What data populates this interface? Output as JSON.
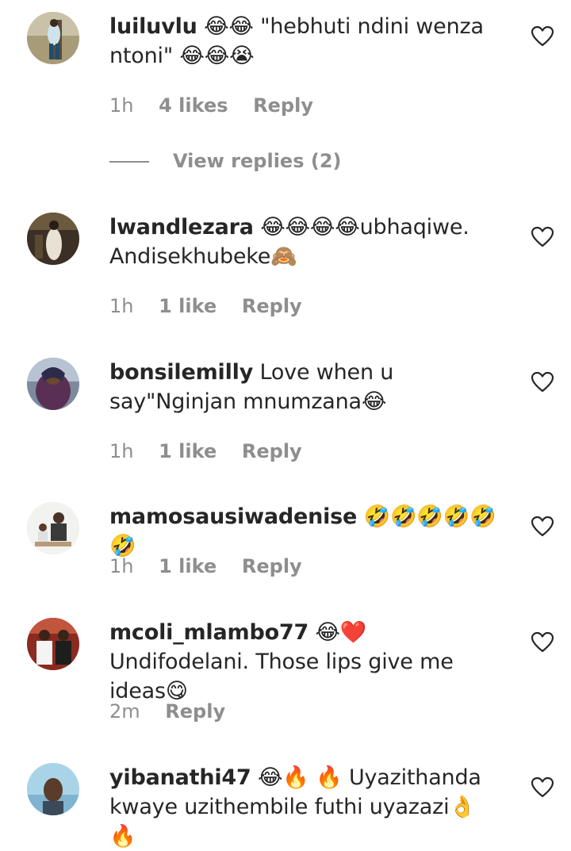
{
  "comments": [
    {
      "username": "luiluvlu",
      "text": "😂😂 \"hebhuti ndini wenza ntoni\" 😂😂😭",
      "time": "1h",
      "likes": "4 likes",
      "reply": "Reply",
      "view_replies": "View replies (2)"
    },
    {
      "username": "lwandlezara",
      "text": "😂😂😂😂ubhaqiwe. Andisekhubeke🙈",
      "time": "1h",
      "likes": "1 like",
      "reply": "Reply"
    },
    {
      "username": "bonsilemilly",
      "text": "Love when u say\"Nginjan mnumzana😂",
      "time": "1h",
      "likes": "1 like",
      "reply": "Reply"
    },
    {
      "username": "mamosausiwadenise",
      "text": "🤣🤣🤣🤣🤣🤣",
      "time": "1h",
      "likes": "1 like",
      "reply": "Reply"
    },
    {
      "username": "mcoli_mlambo77",
      "text": "😂❤️ Undifodelani. Those lips give me ideas😋",
      "time": "2m",
      "reply": "Reply"
    },
    {
      "username": "yibanathi47",
      "text": "😂🔥 🔥 Uyazithanda kwaye uzithembile futhi uyazazi👌 🔥"
    }
  ],
  "icons": {
    "like": "heart-outline-icon"
  }
}
